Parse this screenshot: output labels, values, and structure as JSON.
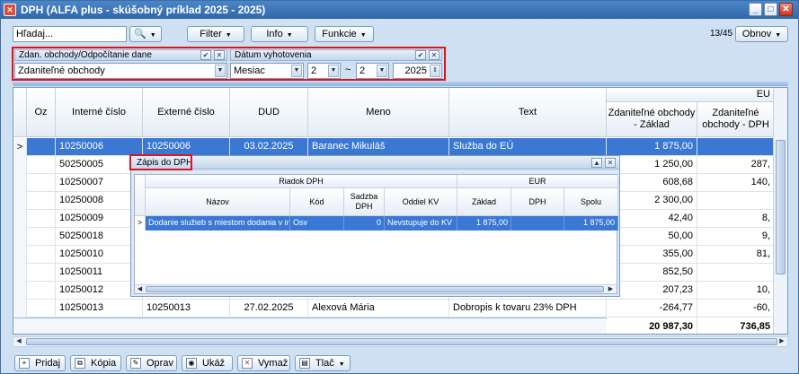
{
  "window": {
    "title": "DPH (ALFA plus - skúšobný príklad 2025 - 2025)"
  },
  "toolbar": {
    "search_placeholder": "Hľadaj...",
    "filter_label": "Filter",
    "info_label": "Info",
    "funkcie_label": "Funkcie",
    "record_count": "13/45",
    "obnov_label": "Obnov"
  },
  "filter_panel": {
    "type_header": "Zdan. obchody/Odpočítanie dane",
    "type_value": "Zdaniteľné obchody",
    "date_header": "Dátum vyhotovenia",
    "period_value": "Mesiac",
    "from_value": "2",
    "range_sep": "~",
    "to_value": "2",
    "year_value": "2025"
  },
  "grid": {
    "group_header": "EU",
    "columns": [
      "Oz",
      "Interné číslo",
      "Externé číslo",
      "DUD",
      "Meno",
      "Text",
      "Zdaniteľné obchody - Základ",
      "Zdaniteľné obchody - DPH"
    ],
    "rows": [
      {
        "interne": "10250006",
        "externe": "10250006",
        "dud": "03.02.2025",
        "meno": "Baranec Mikuláš",
        "text": "Služba do EÚ",
        "zaklad": "1 875,00",
        "dph": ""
      },
      {
        "interne": "50250005",
        "externe": "",
        "dud": "",
        "meno": "",
        "text": "",
        "zaklad": "1 250,00",
        "dph": "287,"
      },
      {
        "interne": "10250007",
        "externe": "",
        "dud": "",
        "meno": "",
        "text": "",
        "zaklad": "608,68",
        "dph": "140,"
      },
      {
        "interne": "10250008",
        "externe": "",
        "dud": "",
        "meno": "",
        "text": "",
        "zaklad": "2 300,00",
        "dph": ""
      },
      {
        "interne": "10250009",
        "externe": "",
        "dud": "",
        "meno": "",
        "text": "",
        "zaklad": "42,40",
        "dph": "8,"
      },
      {
        "interne": "50250018",
        "externe": "",
        "dud": "",
        "meno": "",
        "text": "",
        "zaklad": "50,00",
        "dph": "9,"
      },
      {
        "interne": "10250010",
        "externe": "",
        "dud": "",
        "meno": "",
        "text": "",
        "zaklad": "355,00",
        "dph": "81,"
      },
      {
        "interne": "10250011",
        "externe": "",
        "dud": "",
        "meno": "",
        "text": "",
        "zaklad": "852,50",
        "dph": ""
      },
      {
        "interne": "10250012",
        "externe": "",
        "dud": "",
        "meno": "",
        "text": "",
        "zaklad": "207,23",
        "dph": "10,"
      },
      {
        "interne": "10250013",
        "externe": "10250013",
        "dud": "27.02.2025",
        "meno": "Alexová Mária",
        "text": "Dobropis k tovaru 23% DPH",
        "zaklad": "-264,77",
        "dph": "-60,"
      }
    ],
    "totals": {
      "zaklad": "20 987,30",
      "dph": "736,85"
    }
  },
  "subpanel": {
    "title": "Zápis do DPH",
    "group_riadok": "Riadok DPH",
    "group_eur": "EUR",
    "columns": [
      "Názov",
      "Kód",
      "Sadzba DPH",
      "Oddiel KV",
      "Základ",
      "DPH",
      "Spolu"
    ],
    "row": {
      "nazov": "Dodanie služieb s miestom dodania v inom",
      "kod": "Osv",
      "sadzba": "0",
      "oddiel": "Nevstupuje do KV",
      "zaklad": "1 875,00",
      "dph": "",
      "spolu": "1 875,00"
    }
  },
  "bottom": {
    "pridaj": "Pridaj",
    "kopia": "Kópia",
    "oprav": "Oprav",
    "ukaz": "Ukáž",
    "vymaz": "Vymaž",
    "tlac": "Tlač"
  }
}
